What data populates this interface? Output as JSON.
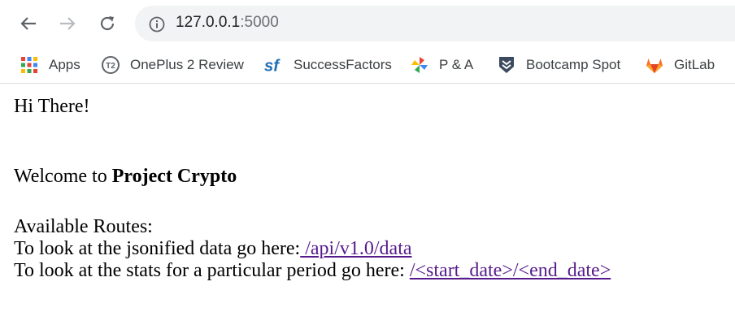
{
  "browser": {
    "url_host": "127.0.0.1",
    "url_port": ":5000",
    "bookmarks": [
      {
        "label": "Apps",
        "icon": "apps-grid-icon"
      },
      {
        "label": "OnePlus 2 Review",
        "icon": "t2-icon"
      },
      {
        "label": "SuccessFactors",
        "icon": "sf-icon"
      },
      {
        "label": "P & A",
        "icon": "pinwheel-icon"
      },
      {
        "label": "Bootcamp Spot",
        "icon": "shield-chevron-icon"
      },
      {
        "label": "GitLab",
        "icon": "gitlab-icon"
      }
    ]
  },
  "page": {
    "greeting": "Hi There!",
    "welcome_prefix": "Welcome to ",
    "welcome_bold": "Project Crypto",
    "routes_heading": "Available Routes:",
    "route1_text": "To look at the jsonified data go here:",
    "route1_link": " /api/v1.0/data",
    "route2_text": "To look at the stats for a particular period go here: ",
    "route2_link": "/<start_date>/<end_date>"
  },
  "colors": {
    "omnibox_bg": "#f1f3f4",
    "visited_link": "#551a8b"
  }
}
